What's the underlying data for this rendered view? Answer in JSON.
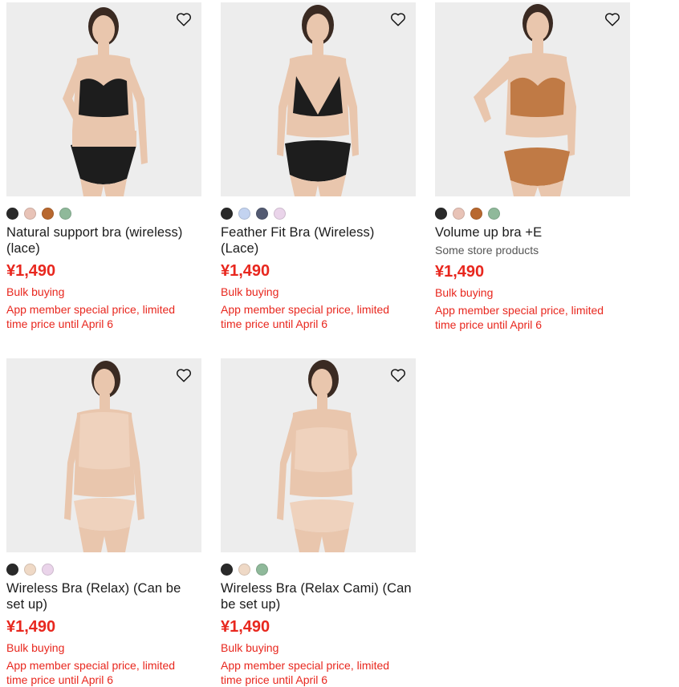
{
  "colors": {
    "accent": "#e8271e",
    "image_bg": "#ededed"
  },
  "products": [
    {
      "name": "Natural support bra (wireless) (lace)",
      "note": "",
      "price": "¥1,490",
      "bulk": "Bulk buying",
      "promo": "App member special price, limited time price until April 6",
      "swatches": [
        "#2a2a2a",
        "#e8c3b7",
        "#b8682f",
        "#8fb99a"
      ],
      "garment": "#1d1d1d"
    },
    {
      "name": "Feather Fit Bra (Wireless) (Lace)",
      "note": "",
      "price": "¥1,490",
      "bulk": "Bulk buying",
      "promo": "App member special price, limited time price until April 6",
      "swatches": [
        "#2a2a2a",
        "#c3d3f0",
        "#535a72",
        "#ead4ea"
      ],
      "garment": "#1d1d1d"
    },
    {
      "name": "Volume up bra +E",
      "note": "Some store products",
      "price": "¥1,490",
      "bulk": "Bulk buying",
      "promo": "App member special price, limited time price until April 6",
      "swatches": [
        "#2a2a2a",
        "#e8c3b7",
        "#b8682f",
        "#8fb99a"
      ],
      "garment": "#c07a45"
    },
    {
      "name": "Wireless Bra (Relax) (Can be set up)",
      "note": "",
      "price": "¥1,490",
      "bulk": "Bulk buying",
      "promo": "App member special price, limited time price until April 6",
      "swatches": [
        "#2a2a2a",
        "#efd9c6",
        "#ead4ea"
      ],
      "garment": "#efd2bd"
    },
    {
      "name": "Wireless Bra (Relax Cami) (Can be set up)",
      "note": "",
      "price": "¥1,490",
      "bulk": "Bulk buying",
      "promo": "App member special price, limited time price until April 6",
      "swatches": [
        "#2a2a2a",
        "#efd9c6",
        "#8fb99a"
      ],
      "garment": "#efd2bd"
    }
  ]
}
